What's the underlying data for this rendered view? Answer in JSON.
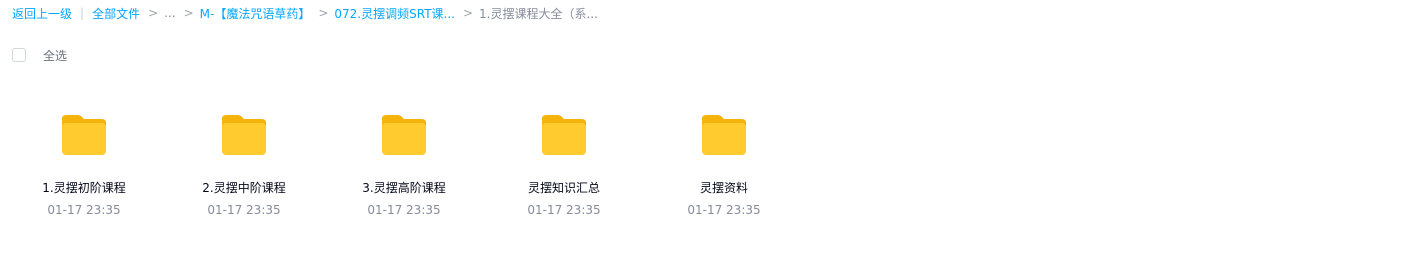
{
  "breadcrumb": {
    "back": "返回上一级",
    "divider": "|",
    "root": "全部文件",
    "ellipsis": "...",
    "level1": "M-【魔法咒语草药】",
    "level2": "072.灵摆调频SRT课...",
    "current": "1.灵摆课程大全（系...",
    "separator": ">"
  },
  "toolbar": {
    "select_all_label": "全选",
    "select_all_checked": false
  },
  "files": [
    {
      "name": "1.灵摆初阶课程",
      "time": "01-17 23:35",
      "icon": "folder-icon"
    },
    {
      "name": "2.灵摆中阶课程",
      "time": "01-17 23:35",
      "icon": "folder-icon"
    },
    {
      "name": "3.灵摆高阶课程",
      "time": "01-17 23:35",
      "icon": "folder-icon"
    },
    {
      "name": "灵摆知识汇总",
      "time": "01-17 23:35",
      "icon": "folder-icon"
    },
    {
      "name": "灵摆资料",
      "time": "01-17 23:35",
      "icon": "folder-icon"
    }
  ],
  "colors": {
    "link": "#06a7ff",
    "folder_back": "#f5b30b",
    "folder_front": "#ffcb2f"
  }
}
